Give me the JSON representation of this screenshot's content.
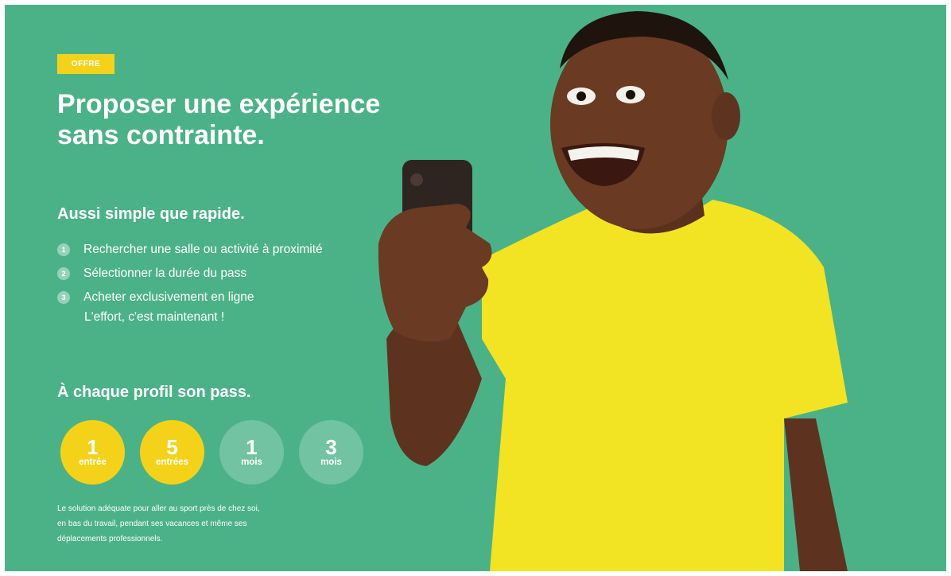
{
  "badge": "OFFRE",
  "title_line1": "Proposer une expérience",
  "title_line2": "sans contrainte.",
  "section1": {
    "title": "Aussi simple que rapide.",
    "steps": [
      {
        "num": "1",
        "label": "Rechercher une salle ou activité à proximité"
      },
      {
        "num": "2",
        "label": "Sélectionner la durée du pass"
      },
      {
        "num": "3",
        "label": "Acheter exclusivement en ligne"
      }
    ],
    "tagline": "L'effort, c'est maintenant !"
  },
  "section2": {
    "title": "À chaque profil son pass.",
    "passes": [
      {
        "num": "1",
        "unit": "entrée"
      },
      {
        "num": "5",
        "unit": "entrées"
      },
      {
        "num": "1",
        "unit": "mois"
      },
      {
        "num": "3",
        "unit": "mois"
      }
    ],
    "description_lines": [
      "Le solution adéquate pour aller au sport près de chez soi,",
      "en bas du travail, pendant ses vacances et même ses",
      "déplacements professionnels."
    ]
  },
  "colors": {
    "background": "#4bb288",
    "accent_yellow": "#f5d21a",
    "text": "#ffffff",
    "shirt": "#f2e422",
    "skin": "#6a3a22",
    "phone": "#2e2420"
  },
  "hero_image": "man-with-smartphone-photo"
}
